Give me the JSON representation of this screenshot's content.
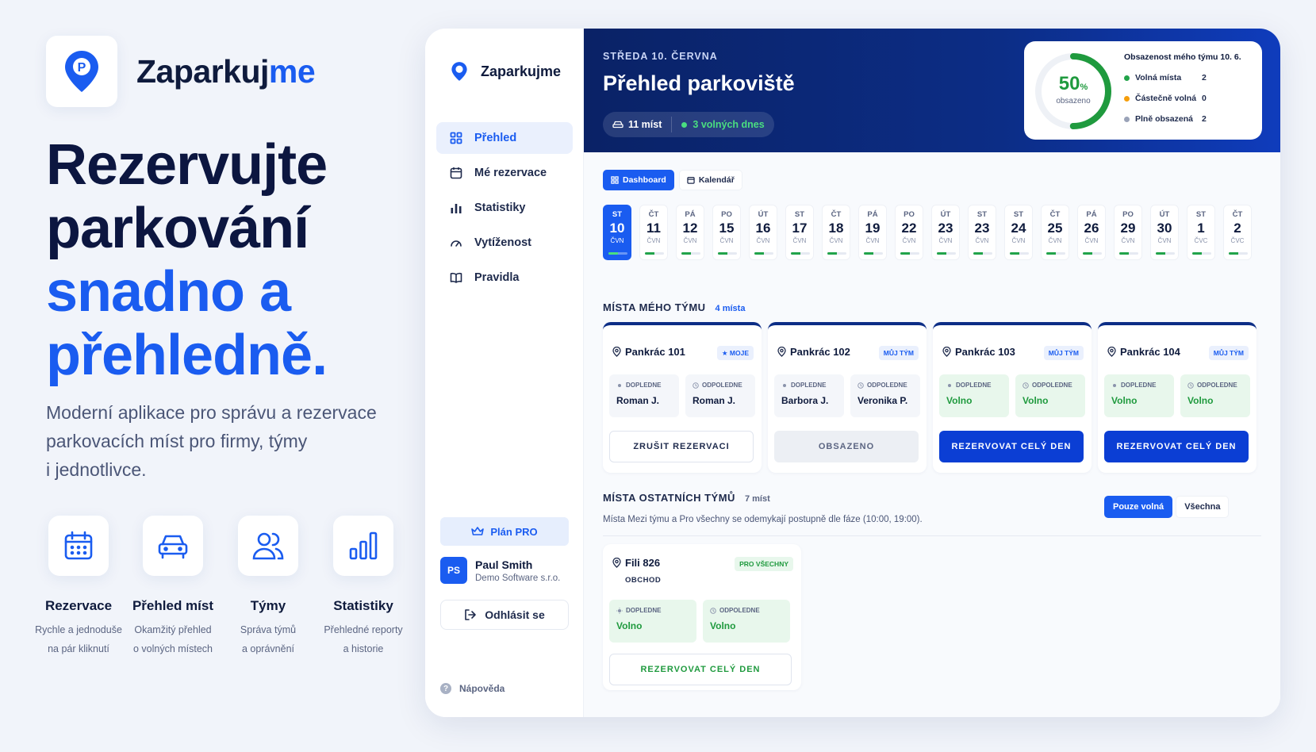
{
  "brand": {
    "name_main": "Zaparkuj",
    "name_accent": "me"
  },
  "hero": {
    "line1": "Rezervujte",
    "line2": "parkování",
    "line3": "snadno a",
    "line4": "přehledně."
  },
  "subtitle": {
    "line1": "Moderní aplikace pro správu a rezervace",
    "line2": "parkovacích míst pro firmy, týmy",
    "line3": "i jednotlivce."
  },
  "features": [
    {
      "title": "Rezervace",
      "desc1": "Rychle a jednoduše",
      "desc2": "na pár kliknutí",
      "icon": "calendar-icon"
    },
    {
      "title": "Přehled míst",
      "desc1": "Okamžitý přehled",
      "desc2": "o volných místech",
      "icon": "car-icon"
    },
    {
      "title": "Týmy",
      "desc1": "Správa týmů",
      "desc2": "a oprávnění",
      "icon": "users-icon"
    },
    {
      "title": "Statistiky",
      "desc1": "Přehledné reporty",
      "desc2": "a historie",
      "icon": "bar-chart-icon"
    }
  ],
  "sidebar": {
    "brand": "Zaparkujme",
    "nav": [
      {
        "label": "Přehled",
        "icon": "grid-icon"
      },
      {
        "label": "Mé rezervace",
        "icon": "calendar-icon"
      },
      {
        "label": "Statistiky",
        "icon": "bar-chart-icon"
      },
      {
        "label": "Vytíženost",
        "icon": "gauge-icon"
      },
      {
        "label": "Pravidla",
        "icon": "book-icon"
      }
    ],
    "plan": "Plán PRO",
    "user": {
      "initials": "PS",
      "name": "Paul Smith",
      "company": "Demo Software s.r.o."
    },
    "logout": "Odhlásit se",
    "help": "Nápověda"
  },
  "banner": {
    "date": "STŘEDA 10. ČERVNA",
    "title": "Přehled parkoviště",
    "places": "11 míst",
    "free": "3 volných dnes",
    "occupancy": {
      "percent": 50,
      "percent_text": "50",
      "percent_sign": "%",
      "label": "obsazeno",
      "title": "Obsazenost mého týmu 10. 6.",
      "rows": [
        {
          "label": "Volná místa",
          "value": "2",
          "color": "#22a34a"
        },
        {
          "label": "Částečně volná",
          "value": "0",
          "color": "#f59e0b"
        },
        {
          "label": "Plně obsazená",
          "value": "2",
          "color": "#9aa3b8"
        }
      ]
    }
  },
  "tabs": {
    "dashboard": "Dashboard",
    "calendar": "Kalendář"
  },
  "days": [
    {
      "w": "ST",
      "n": "10",
      "m": "ČVN",
      "fill": 0.5
    },
    {
      "w": "ČT",
      "n": "11",
      "m": "ČVN",
      "fill": 0.5
    },
    {
      "w": "PÁ",
      "n": "12",
      "m": "ČVN",
      "fill": 0.5
    },
    {
      "w": "PO",
      "n": "15",
      "m": "ČVN",
      "fill": 0.5
    },
    {
      "w": "ÚT",
      "n": "16",
      "m": "ČVN",
      "fill": 0.5
    },
    {
      "w": "ST",
      "n": "17",
      "m": "ČVN",
      "fill": 0.5
    },
    {
      "w": "ČT",
      "n": "18",
      "m": "ČVN",
      "fill": 0.5
    },
    {
      "w": "PÁ",
      "n": "19",
      "m": "ČVN",
      "fill": 0.5
    },
    {
      "w": "PO",
      "n": "22",
      "m": "ČVN",
      "fill": 0.5
    },
    {
      "w": "ÚT",
      "n": "23",
      "m": "ČVN",
      "fill": 0.5
    },
    {
      "w": "ST",
      "n": "23",
      "m": "ČVN",
      "fill": 0.5
    },
    {
      "w": "ST",
      "n": "24",
      "m": "ČVN",
      "fill": 0.5
    },
    {
      "w": "ČT",
      "n": "25",
      "m": "ČVN",
      "fill": 0.5
    },
    {
      "w": "PÁ",
      "n": "26",
      "m": "ČVN",
      "fill": 0.5
    },
    {
      "w": "PO",
      "n": "29",
      "m": "ČVN",
      "fill": 0.5
    },
    {
      "w": "ÚT",
      "n": "30",
      "m": "ČVN",
      "fill": 0.5
    },
    {
      "w": "ST",
      "n": "1",
      "m": "ČVC",
      "fill": 0.5
    },
    {
      "w": "ČT",
      "n": "2",
      "m": "ČVC",
      "fill": 0.5
    }
  ],
  "team_section": {
    "title": "MÍSTA MÉHO TÝMU",
    "count": "4 místa"
  },
  "slot_labels": {
    "morning": "DOPLEDNE",
    "afternoon": "ODPOLEDNE"
  },
  "team_cards": [
    {
      "name": "Pankrác 101",
      "badge": "★ MOJE",
      "am": "Roman J.",
      "pm": "Roman J.",
      "am_free": false,
      "pm_free": false,
      "button": "ZRUŠIT REZERVACI",
      "btn_style": "outline"
    },
    {
      "name": "Pankrác 102",
      "badge": "MŮJ TÝM",
      "am": "Barbora J.",
      "pm": "Veronika P.",
      "am_free": false,
      "pm_free": false,
      "button": "OBSAZENO",
      "btn_style": "gray"
    },
    {
      "name": "Pankrác 103",
      "badge": "MŮJ TÝM",
      "am": "Volno",
      "pm": "Volno",
      "am_free": true,
      "pm_free": true,
      "button": "REZERVOVAT CELÝ DEN",
      "btn_style": "blue"
    },
    {
      "name": "Pankrác 104",
      "badge": "MŮJ TÝM",
      "am": "Volno",
      "pm": "Volno",
      "am_free": true,
      "pm_free": true,
      "button": "REZERVOVAT CELÝ DEN",
      "btn_style": "blue"
    }
  ],
  "other_section": {
    "title": "MÍSTA OSTATNÍCH TÝMŮ",
    "count": "7 míst"
  },
  "filters": {
    "free_only": "Pouze volná",
    "all": "Všechna"
  },
  "info_line": "Místa Mezi týmu a Pro všechny se odemykají postupně dle fáze (10:00, 19:00).",
  "other_card": {
    "name": "Fili 826",
    "sub": "OBCHOD",
    "badge": "PRO VŠECHNY",
    "am": "Volno",
    "pm": "Volno",
    "button": "REZERVOVAT CELÝ DEN"
  },
  "colors": {
    "accent": "#1a5cf0",
    "navy": "#0c2d86",
    "green": "#1f9a3e"
  }
}
